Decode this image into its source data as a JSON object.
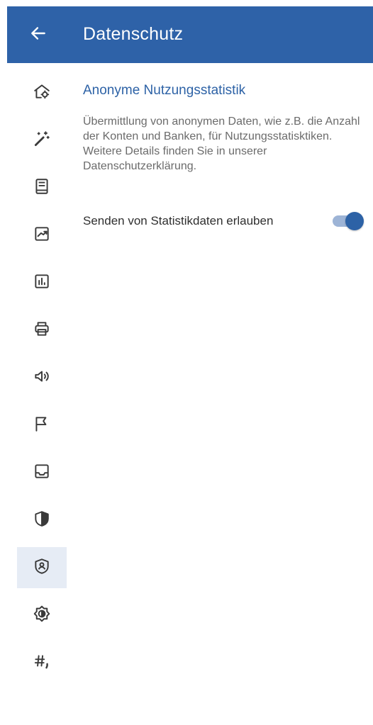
{
  "header": {
    "title": "Datenschutz",
    "back_icon": "arrow-left-icon",
    "background_color": "#2e62a8"
  },
  "rail": {
    "selected_index": 11,
    "items": [
      {
        "icon": "house-settings-icon"
      },
      {
        "icon": "magic-wand-icon"
      },
      {
        "icon": "book-icon"
      },
      {
        "icon": "trend-chart-icon"
      },
      {
        "icon": "bar-chart-icon"
      },
      {
        "icon": "printer-icon"
      },
      {
        "icon": "speaker-icon"
      },
      {
        "icon": "flag-icon"
      },
      {
        "icon": "inbox-icon"
      },
      {
        "icon": "shield-icon"
      },
      {
        "icon": "privacy-shield-user-icon"
      },
      {
        "icon": "brightness-icon"
      },
      {
        "icon": "number-format-icon"
      }
    ]
  },
  "section": {
    "title": "Anonyme Nutzungsstatistik",
    "description": "Übermittlung von anonymen Daten, wie z.B. die Anzahl der Konten und Banken, für Nutzungsstatisktiken. Weitere Details finden Sie in unserer Datenschutzerklärung."
  },
  "setting": {
    "label": "Senden von Statistikdaten erlauben",
    "enabled": true,
    "accent_color": "#2d62a6"
  }
}
